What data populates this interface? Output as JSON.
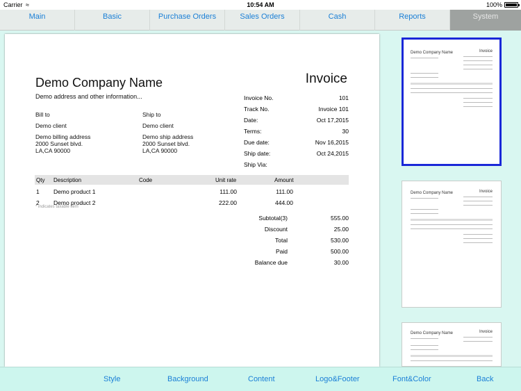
{
  "status_bar": {
    "carrier": "Carrier",
    "time": "10:54 AM",
    "battery": "100%"
  },
  "top_nav": {
    "tabs": [
      {
        "label": "Main"
      },
      {
        "label": "Basic"
      },
      {
        "label": "Purchase Orders"
      },
      {
        "label": "Sales Orders"
      },
      {
        "label": "Cash"
      },
      {
        "label": "Reports"
      },
      {
        "label": "System",
        "selected": true
      }
    ]
  },
  "invoice": {
    "company_name": "Demo Company Name",
    "company_address": "Demo address and other information...",
    "title": "Invoice",
    "bill_to_label": "Bill to",
    "bill_to_name": "Demo client",
    "bill_to_address1": "Demo billing address",
    "bill_to_address2": "2000 Sunset blvd.",
    "bill_to_address3": "LA,CA 90000",
    "ship_to_label": "Ship to",
    "ship_to_name": "Demo client",
    "ship_to_address1": "Demo ship address",
    "ship_to_address2": "2000 Sunset blvd.",
    "ship_to_address3": "LA,CA 90000",
    "meta": [
      {
        "label": "Invoice No.",
        "value": "101"
      },
      {
        "label": "Track No.",
        "value": "Invoice 101"
      },
      {
        "label": "Date:",
        "value": "Oct 17,2015"
      },
      {
        "label": "Terms:",
        "value": "30"
      },
      {
        "label": "Due date:",
        "value": "Nov 16,2015"
      },
      {
        "label": "Ship date:",
        "value": "Oct 24,2015"
      },
      {
        "label": "Ship Via:",
        "value": ""
      }
    ],
    "columns": {
      "qty": "Qty",
      "description": "Description",
      "code": "Code",
      "unit_rate": "Unit rate",
      "amount": "Amount"
    },
    "items": [
      {
        "qty": "1",
        "description": "Demo product 1",
        "code": "",
        "unit_rate": "111.00",
        "amount": "111.00"
      },
      {
        "qty": "2",
        "description": "Demo product 2",
        "code": "",
        "unit_rate": "222.00",
        "amount": "444.00"
      }
    ],
    "footnote": "* indicates taxable item",
    "totals": [
      {
        "label": "Subtotal(3)",
        "value": "555.00"
      },
      {
        "label": "Discount",
        "value": "25.00"
      },
      {
        "label": "Total",
        "value": "530.00"
      },
      {
        "label": "Paid",
        "value": "500.00"
      },
      {
        "label": "Balance due",
        "value": "30.00"
      }
    ]
  },
  "bottom_nav": {
    "buttons": [
      {
        "label": "Style"
      },
      {
        "label": "Background"
      },
      {
        "label": "Content"
      },
      {
        "label": "Logo&Footer"
      },
      {
        "label": "Font&Color"
      },
      {
        "label": "Back"
      }
    ]
  },
  "colors": {
    "accent": "#1a7fd6",
    "selected_thumb_border": "#1a28d8",
    "sidebar_bg": "#d9f7f1"
  }
}
